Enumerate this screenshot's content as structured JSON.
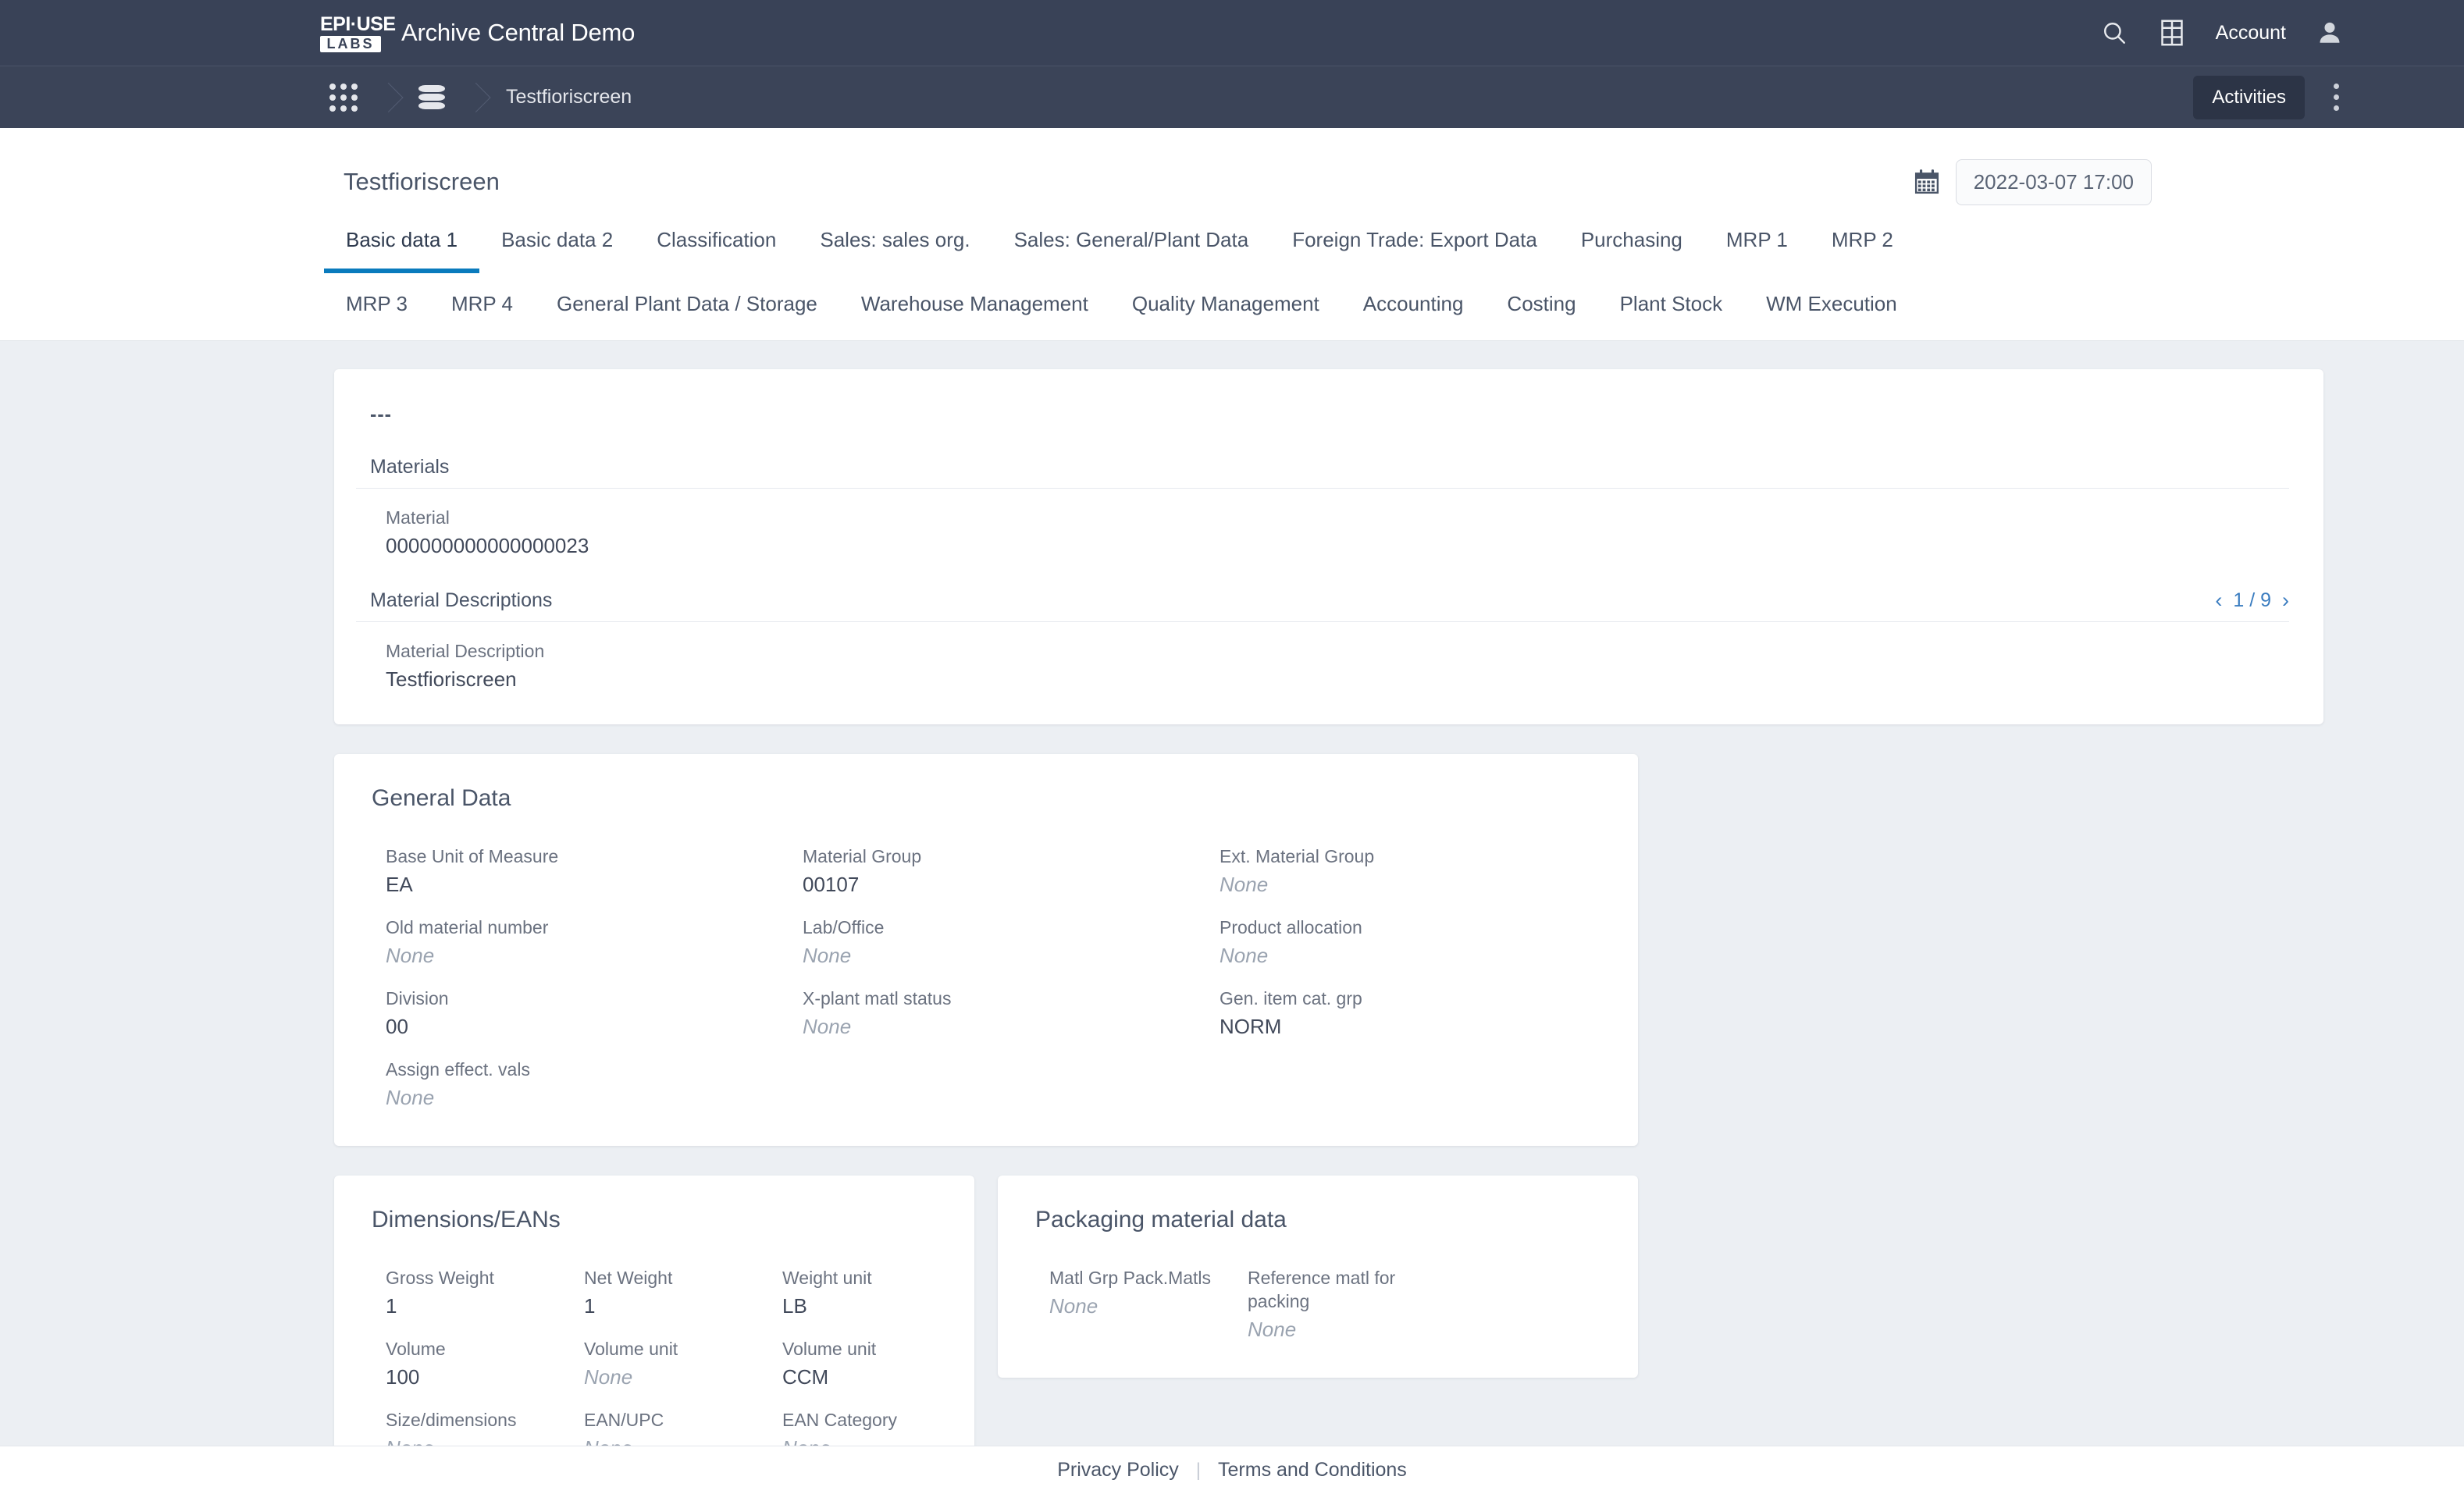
{
  "shellbar": {
    "logo_top": "EPI·USE",
    "logo_bottom": "LABS",
    "title": "Archive Central Demo",
    "search_icon": "search-icon",
    "grid_icon": "table-grid-icon",
    "account_label": "Account",
    "avatar_icon": "user-avatar-icon"
  },
  "navbar": {
    "apps_icon": "app-grid-icon",
    "database_icon": "database-icon",
    "breadcrumb_label": "Testfioriscreen",
    "activities_label": "Activities",
    "overflow_icon": "vertical-dots-icon"
  },
  "objheader": {
    "title": "Testfioriscreen",
    "calendar_icon": "calendar-icon",
    "date_value": "2022-03-07 17:00"
  },
  "tabs": {
    "row1": [
      {
        "label": "Basic data 1",
        "active": true
      },
      {
        "label": "Basic data 2",
        "active": false
      },
      {
        "label": "Classification",
        "active": false
      },
      {
        "label": "Sales: sales org.",
        "active": false
      },
      {
        "label": "Sales: General/Plant Data",
        "active": false
      },
      {
        "label": "Foreign Trade: Export Data",
        "active": false
      },
      {
        "label": "Purchasing",
        "active": false
      },
      {
        "label": "MRP 1",
        "active": false
      },
      {
        "label": "MRP 2",
        "active": false
      }
    ],
    "row2": [
      {
        "label": "MRP 3",
        "active": false
      },
      {
        "label": "MRP 4",
        "active": false
      },
      {
        "label": "General Plant Data / Storage",
        "active": false
      },
      {
        "label": "Warehouse Management",
        "active": false
      },
      {
        "label": "Quality Management",
        "active": false
      },
      {
        "label": "Accounting",
        "active": false
      },
      {
        "label": "Costing",
        "active": false
      },
      {
        "label": "Plant Stock",
        "active": false
      },
      {
        "label": "WM Execution",
        "active": false
      }
    ]
  },
  "material_card": {
    "title": "---",
    "materials_section": "Materials",
    "material_label": "Material",
    "material_value": "000000000000000023",
    "descriptions_section": "Material Descriptions",
    "pager": {
      "prev": "‹",
      "text": "1 / 9",
      "next": "›"
    },
    "description_label": "Material Description",
    "description_value": "Testfioriscreen"
  },
  "general_data": {
    "title": "General Data",
    "fields": [
      {
        "label": "Base Unit of Measure",
        "value": "EA",
        "none": false
      },
      {
        "label": "Material Group",
        "value": "00107",
        "none": false
      },
      {
        "label": "Ext. Material Group",
        "value": "None",
        "none": true
      },
      {
        "label": "Old material number",
        "value": "None",
        "none": true
      },
      {
        "label": "Lab/Office",
        "value": "None",
        "none": true
      },
      {
        "label": "Product allocation",
        "value": "None",
        "none": true
      },
      {
        "label": "Division",
        "value": "00",
        "none": false
      },
      {
        "label": "X-plant matl status",
        "value": "None",
        "none": true
      },
      {
        "label": "Gen. item cat. grp",
        "value": "NORM",
        "none": false
      },
      {
        "label": "Assign effect. vals",
        "value": "None",
        "none": true
      }
    ]
  },
  "dimensions": {
    "title": "Dimensions/EANs",
    "fields": [
      {
        "label": "Gross Weight",
        "value": "1",
        "none": false
      },
      {
        "label": "Net Weight",
        "value": "1",
        "none": false
      },
      {
        "label": "Weight unit",
        "value": "LB",
        "none": false
      },
      {
        "label": "Volume",
        "value": "100",
        "none": false
      },
      {
        "label": "Volume unit",
        "value": "None",
        "none": true
      },
      {
        "label": "Volume unit",
        "value": "CCM",
        "none": false
      },
      {
        "label": "Size/dimensions",
        "value": "None",
        "none": true
      },
      {
        "label": "EAN/UPC",
        "value": "None",
        "none": true
      },
      {
        "label": "EAN Category",
        "value": "None",
        "none": true
      }
    ]
  },
  "packaging": {
    "title": "Packaging material data",
    "fields": [
      {
        "label": "Matl Grp Pack.Matls",
        "value": "None",
        "none": true
      },
      {
        "label": "Reference matl for packing",
        "value": "None",
        "none": true
      }
    ]
  },
  "footer": {
    "privacy": "Privacy Policy",
    "divider": "|",
    "terms": "Terms and Conditions"
  },
  "colors": {
    "shell_bg": "#394257",
    "nav_bg": "#3b4458",
    "accent": "#0a7bbd",
    "page_bg": "#eceff3",
    "link": "#3b7dc0"
  }
}
